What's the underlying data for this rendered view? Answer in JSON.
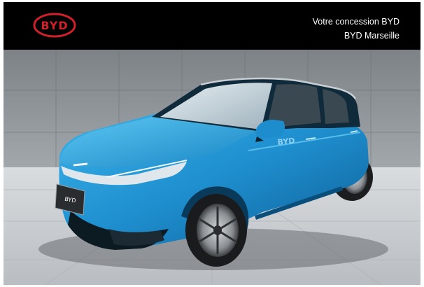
{
  "header": {
    "logo_text": "BYD",
    "dealer_line1": "Votre concession BYD",
    "dealer_line2": "BYD Marseille"
  },
  "photo": {
    "subject": "car",
    "plate_text": "BYD",
    "side_badge_text": "BYD"
  },
  "colors": {
    "header_bg": "#000000",
    "brand_red": "#d0202a",
    "car_body": "#1f8fcf",
    "studio_wall": "#8f9499",
    "studio_floor": "#c9ccd0"
  }
}
